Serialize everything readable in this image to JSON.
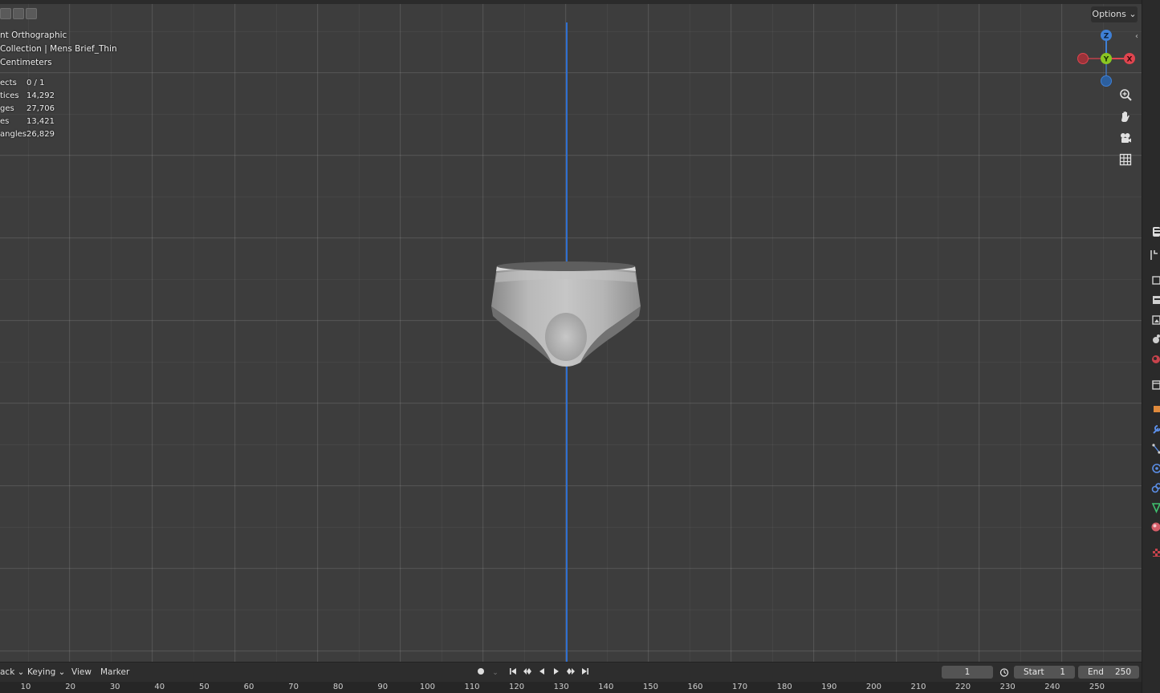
{
  "viewport": {
    "view_name": "nt Orthographic",
    "collection": "Collection | Mens Brief_Thin",
    "units": "Centimeters",
    "stats": [
      {
        "label": "ects",
        "value": "0 / 1"
      },
      {
        "label": "tices",
        "value": "14,292"
      },
      {
        "label": "ges",
        "value": "27,706"
      },
      {
        "label": "es",
        "value": "13,421"
      },
      {
        "label": "angles",
        "value": "26,829"
      }
    ],
    "options_label": "Options",
    "gizmo": {
      "x": "X",
      "y": "Y",
      "z": "Z"
    },
    "colors": {
      "x_axis": "#e0454f",
      "y_axis": "#8ac722",
      "z_axis": "#3f80d6",
      "grid_line_z": "#2f6fd0"
    }
  },
  "timeline": {
    "menu": [
      "ack",
      "Keying",
      "View",
      "Marker"
    ],
    "current_frame": "1",
    "start_label": "Start",
    "start_value": "1",
    "end_label": "End",
    "end_value": "250",
    "ruler_ticks": [
      "10",
      "20",
      "30",
      "40",
      "50",
      "60",
      "70",
      "80",
      "90",
      "100",
      "110",
      "120",
      "130",
      "140",
      "150",
      "160",
      "170",
      "180",
      "190",
      "200",
      "210",
      "220",
      "230",
      "240",
      "250"
    ]
  }
}
